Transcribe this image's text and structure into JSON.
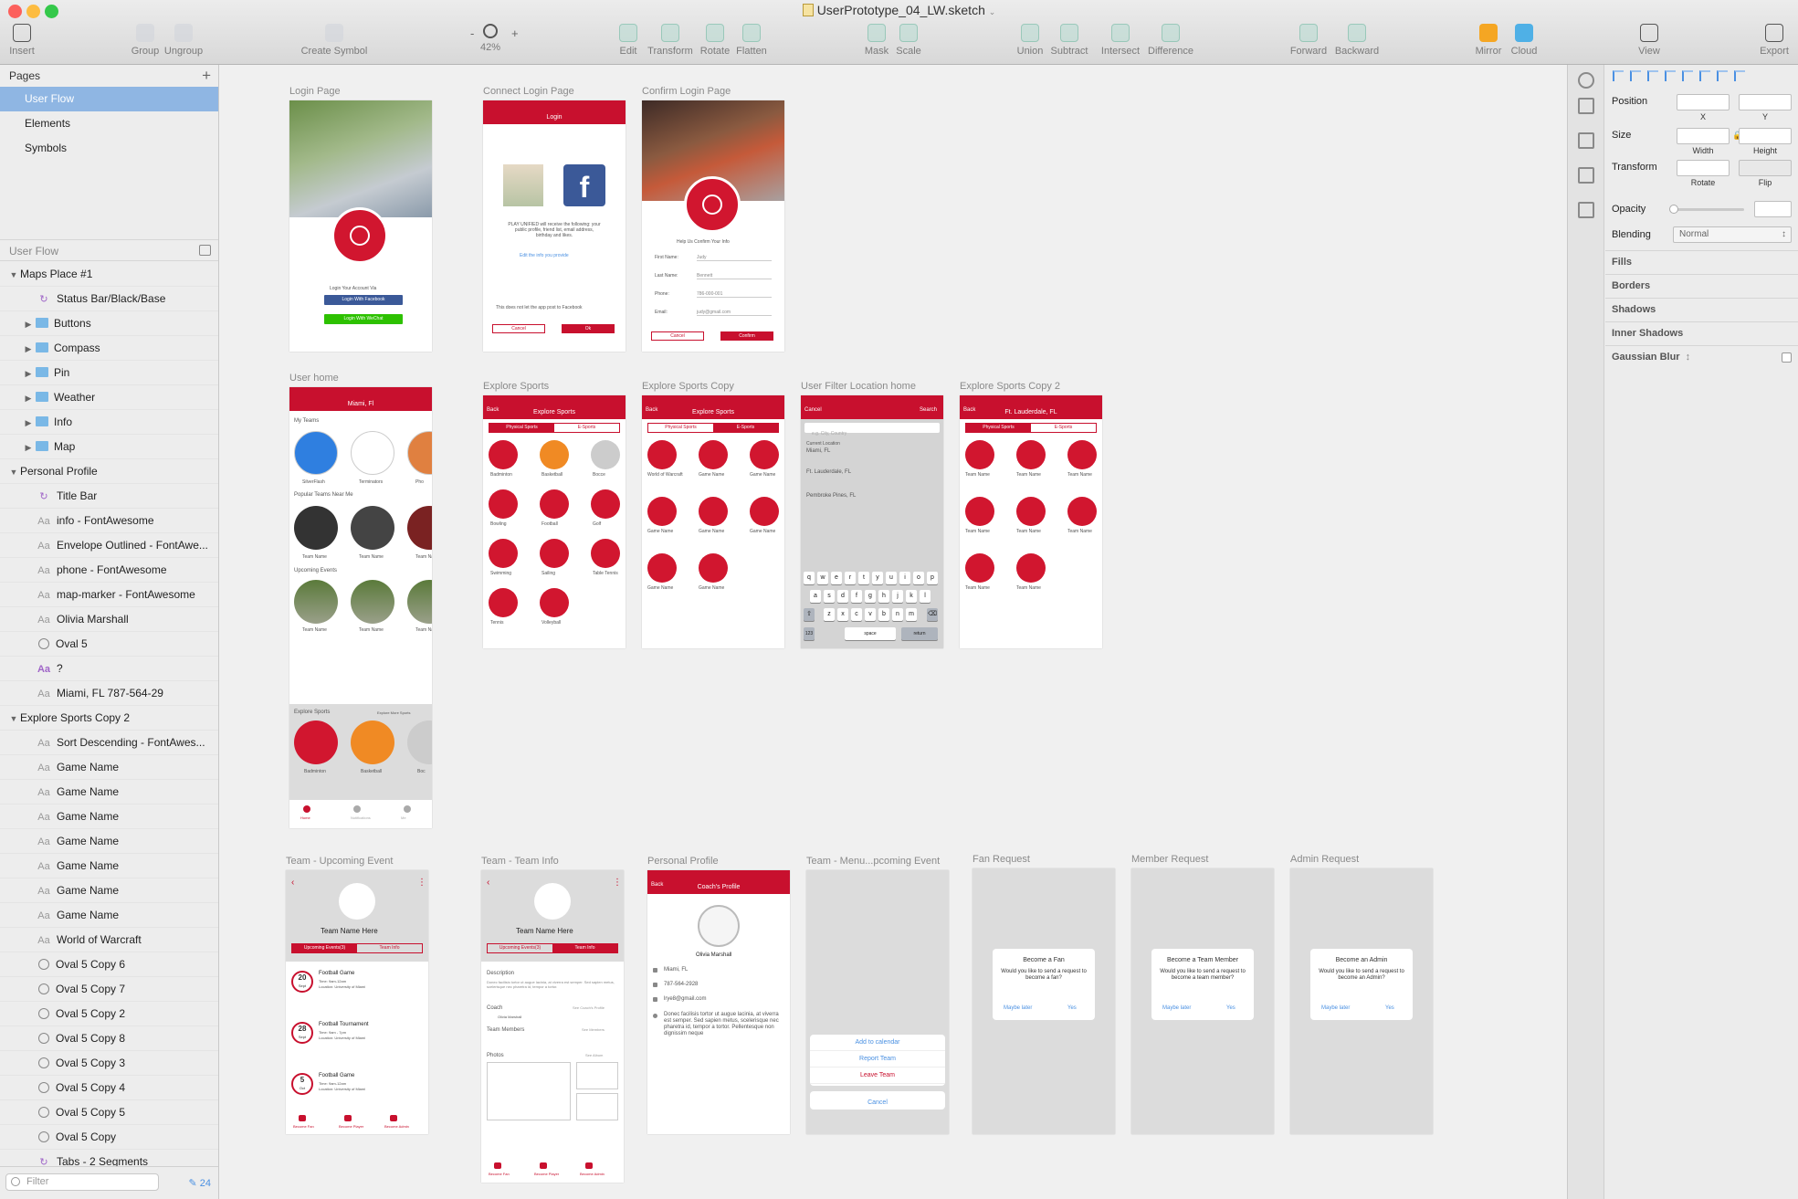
{
  "window": {
    "title": "UserPrototype_04_LW.sketch"
  },
  "toolbar": [
    {
      "id": "insert",
      "label": "Insert",
      "icon": "plus-icon"
    },
    {
      "id": "group",
      "label": "Group",
      "icon": "group-icon"
    },
    {
      "id": "ungroup",
      "label": "Ungroup",
      "icon": "ungroup-icon"
    },
    {
      "id": "create-symbol",
      "label": "Create Symbol",
      "icon": "symbol-icon"
    },
    {
      "id": "zoom",
      "label": "42%",
      "icon": "magnifier-icon"
    },
    {
      "id": "edit",
      "label": "Edit",
      "icon": "pen-icon"
    },
    {
      "id": "transform",
      "label": "Transform",
      "icon": "transform-icon"
    },
    {
      "id": "rotate",
      "label": "Rotate",
      "icon": "rotate-icon"
    },
    {
      "id": "flatten",
      "label": "Flatten",
      "icon": "flatten-icon"
    },
    {
      "id": "mask",
      "label": "Mask",
      "icon": "mask-icon"
    },
    {
      "id": "scale",
      "label": "Scale",
      "icon": "scale-icon"
    },
    {
      "id": "union",
      "label": "Union",
      "icon": "union-icon"
    },
    {
      "id": "subtract",
      "label": "Subtract",
      "icon": "subtract-icon"
    },
    {
      "id": "intersect",
      "label": "Intersect",
      "icon": "intersect-icon"
    },
    {
      "id": "difference",
      "label": "Difference",
      "icon": "difference-icon"
    },
    {
      "id": "forward",
      "label": "Forward",
      "icon": "forward-icon"
    },
    {
      "id": "backward",
      "label": "Backward",
      "icon": "backward-icon"
    },
    {
      "id": "mirror",
      "label": "Mirror",
      "icon": "mirror-icon"
    },
    {
      "id": "cloud",
      "label": "Cloud",
      "icon": "cloud-icon"
    },
    {
      "id": "view",
      "label": "View",
      "icon": "view-icon"
    },
    {
      "id": "export",
      "label": "Export",
      "icon": "export-icon"
    }
  ],
  "zoom": {
    "minus": "-",
    "plus": "+"
  },
  "pages": {
    "header": "Pages",
    "items": [
      "User Flow",
      "Elements",
      "Symbols"
    ],
    "selected": "User Flow"
  },
  "layers_header": "User Flow",
  "layers": [
    {
      "label": "Maps Place #1",
      "kind": "group"
    },
    {
      "label": "Status Bar/Black/Base",
      "kind": "symbol"
    },
    {
      "label": "Buttons",
      "kind": "folder"
    },
    {
      "label": "Compass",
      "kind": "folder"
    },
    {
      "label": "Pin",
      "kind": "folder"
    },
    {
      "label": "Weather",
      "kind": "folder"
    },
    {
      "label": "Info",
      "kind": "folder"
    },
    {
      "label": "Map",
      "kind": "folder"
    },
    {
      "label": "Personal Profile",
      "kind": "group"
    },
    {
      "label": "Title Bar",
      "kind": "symbol"
    },
    {
      "label": "info - FontAwesome",
      "kind": "text"
    },
    {
      "label": "Envelope Outlined - FontAwe...",
      "kind": "text"
    },
    {
      "label": "phone - FontAwesome",
      "kind": "text"
    },
    {
      "label": "map-marker - FontAwesome",
      "kind": "text"
    },
    {
      "label": "Olivia Marshall",
      "kind": "text"
    },
    {
      "label": "Oval 5",
      "kind": "oval"
    },
    {
      "label": "?",
      "kind": "text-purple"
    },
    {
      "label": "Miami, FL 787-564-29",
      "kind": "text"
    },
    {
      "label": "Explore Sports Copy 2",
      "kind": "group"
    },
    {
      "label": "Sort Descending - FontAwes...",
      "kind": "text"
    },
    {
      "label": "Game Name",
      "kind": "text"
    },
    {
      "label": "Game Name",
      "kind": "text"
    },
    {
      "label": "Game Name",
      "kind": "text"
    },
    {
      "label": "Game Name",
      "kind": "text"
    },
    {
      "label": "Game Name",
      "kind": "text"
    },
    {
      "label": "Game Name",
      "kind": "text"
    },
    {
      "label": "Game Name",
      "kind": "text"
    },
    {
      "label": "World of Warcraft",
      "kind": "text"
    },
    {
      "label": "Oval 5 Copy 6",
      "kind": "oval"
    },
    {
      "label": "Oval 5 Copy 7",
      "kind": "oval"
    },
    {
      "label": "Oval 5 Copy 2",
      "kind": "oval"
    },
    {
      "label": "Oval 5 Copy 8",
      "kind": "oval"
    },
    {
      "label": "Oval 5 Copy 3",
      "kind": "oval"
    },
    {
      "label": "Oval 5 Copy 4",
      "kind": "oval"
    },
    {
      "label": "Oval 5 Copy 5",
      "kind": "oval"
    },
    {
      "label": "Oval 5 Copy",
      "kind": "oval"
    },
    {
      "label": "Tabs - 2 Segments",
      "kind": "symbol"
    }
  ],
  "filter": {
    "placeholder": "Filter",
    "count": "24"
  },
  "artboards": [
    {
      "title": "Login Page",
      "type": "login"
    },
    {
      "title": "Connect Login Page",
      "type": "connect"
    },
    {
      "title": "Confirm Login Page",
      "type": "confirm"
    },
    {
      "title": "User home",
      "type": "home"
    },
    {
      "title": "Explore Sports",
      "type": "explore"
    },
    {
      "title": "Explore Sports Copy",
      "type": "explore2"
    },
    {
      "title": "User Filter Location home",
      "type": "filter"
    },
    {
      "title": "Explore Sports Copy 2",
      "type": "explore3"
    },
    {
      "title": "Team - Upcoming Event",
      "type": "team-events"
    },
    {
      "title": "Team - Team Info",
      "type": "team-info"
    },
    {
      "title": "Personal Profile",
      "type": "profile"
    },
    {
      "title": "Team - Menu...pcoming Event",
      "type": "menu"
    },
    {
      "title": "Fan Request",
      "type": "fan"
    },
    {
      "title": "Member Request",
      "type": "member"
    },
    {
      "title": "Admin Request",
      "type": "admin"
    }
  ],
  "screens": {
    "login": {
      "account_via": "Login Your Account Via",
      "facebook": "Login With Facebook",
      "wechat": "Login With WeChat"
    },
    "connect": {
      "header": "Login",
      "notice": "PLAY UNIFIED will receive the following: your public profile, friend list, email address, birthday and likes.",
      "edit_link": "Edit the info you provide",
      "no_post": "This does not let the app post to Facebook",
      "cancel": "Cancel",
      "ok": "Ok"
    },
    "confirm": {
      "heading": "Help Us Confirm Your Info",
      "fields": [
        {
          "label": "First Name:",
          "value": "Judy"
        },
        {
          "label": "Last Name:",
          "value": "Bennett"
        },
        {
          "label": "Phone:",
          "value": "786-000-001"
        },
        {
          "label": "Email:",
          "value": "judy@gmail.com"
        }
      ],
      "cancel": "Cancel",
      "confirm": "Confirm"
    },
    "home": {
      "location": "Miami, Fl",
      "my_teams": "My Teams",
      "teams": [
        "SilverFlash",
        "Terminators",
        "Pho"
      ],
      "popular": "Popular Teams Near Me",
      "team_name": "Team Name",
      "upcoming": "Upcoming Events",
      "event_team": "Team Name",
      "explore": "Explore Sports",
      "explore_more": "Explore More Sports",
      "sports": [
        "Badminton",
        "Basketball",
        "Boc"
      ],
      "tabs": [
        "Home",
        "Notifications",
        "Me"
      ]
    },
    "explore": {
      "back": "Back",
      "title": "Explore Sports",
      "seg": [
        "Physical Sports",
        "E-Sports"
      ],
      "sports": [
        "Badminton",
        "Basketball",
        "Bocce",
        "Bowling",
        "Football",
        "Golf",
        "Swimming",
        "Sailing",
        "Table Tennis",
        "Tennis",
        "Volleyball"
      ]
    },
    "explore2": {
      "back": "Back",
      "title": "Explore Sports",
      "seg": [
        "Physical Sports",
        "E-Sports"
      ],
      "games": [
        "World of Warcraft",
        "Game Name",
        "Game Name",
        "Game Name",
        "Game Name",
        "Game Name",
        "Game Name",
        "Game Name"
      ]
    },
    "filter": {
      "cancel": "Cancel",
      "search": "Search",
      "placeholder": "e.g. City, Country",
      "current_label": "Current Location",
      "current_value": "Miami, FL",
      "options": [
        "Ft. Lauderdale, FL",
        "Pembroke Pines, FL"
      ],
      "keys1": [
        "q",
        "w",
        "e",
        "r",
        "t",
        "y",
        "u",
        "i",
        "o",
        "p"
      ],
      "keys2": [
        "a",
        "s",
        "d",
        "f",
        "g",
        "h",
        "j",
        "k",
        "l"
      ],
      "keys3": [
        "z",
        "x",
        "c",
        "v",
        "b",
        "n",
        "m"
      ],
      "space": "space",
      "return": "return",
      "num": "123"
    },
    "explore3": {
      "back": "Back",
      "location": "Ft. Lauderdale, FL",
      "seg": [
        "Physical Sports",
        "E-Sports"
      ],
      "team_name": "Team Name"
    },
    "team_events": {
      "team_name": "Team Name Here",
      "seg": [
        "Upcoming Events(3)",
        "Team Info"
      ],
      "events": [
        {
          "day": "20",
          "month": "Sept",
          "title": "Football Game",
          "time": "Time: 9am-12am",
          "loc": "Location: University of Miami"
        },
        {
          "day": "28",
          "month": "Sept",
          "title": "Football Tournament",
          "time": "Time: 9am - 7pm",
          "loc": "Location: University of Miami"
        },
        {
          "day": "5",
          "month": "Oct",
          "title": "Football Game",
          "time": "Time: 9am-12am",
          "loc": "Location: University of Miami"
        }
      ],
      "actions": [
        "Become Fan",
        "Become Player",
        "Become Admin"
      ]
    },
    "team_info": {
      "team_name": "Team Name Here",
      "seg": [
        "Upcoming Events(3)",
        "Team Info"
      ],
      "description": "Description",
      "desc_text": "Donec facilisis tortor ut augue lacinia, at viverra est semper. Sed sapien metus, scelerisque nec pharetra id, tempor a tortor.",
      "coach": "Coach",
      "coach_name": "Olivia Marshall",
      "members": "Team Members",
      "photos": "Photos",
      "see_profile": "See Coach's Profile",
      "see_members": "See Members",
      "see_album": "See Album",
      "actions": [
        "Become Fan",
        "Become Player",
        "Become Admin"
      ]
    },
    "profile": {
      "back": "Back",
      "title": "Coach's Profile",
      "name": "Olivia Marshall",
      "location": "Miami, FL",
      "phone": "787-564-2928",
      "email": "lrye8@gmail.com",
      "bio": "Donec facilisis tortor ut augue lacinia, at viverra est semper. Sed sapien metus, scelerisque nec pharetra id, tempor a tortor. Pellentesque non dignissim neque"
    },
    "menu": {
      "items": [
        "Add to calendar",
        "Report Team",
        "Leave Team"
      ],
      "cancel": "Cancel"
    },
    "fan": {
      "title": "Become a Fan",
      "body": "Would you like to send a request to become a fan?",
      "maybe": "Maybe later",
      "yes": "Yes"
    },
    "member": {
      "title": "Become a Team Member",
      "body": "Would you like to send a request to become a team member?",
      "maybe": "Maybe later",
      "yes": "Yes"
    },
    "admin": {
      "title": "Become an Admin",
      "body": "Would you like to send a request to become an Admin?",
      "maybe": "Maybe later",
      "yes": "Yes"
    }
  },
  "inspector": {
    "position": "Position",
    "x": "X",
    "y": "Y",
    "size": "Size",
    "width": "Width",
    "height": "Height",
    "transform": "Transform",
    "rotate": "Rotate",
    "flip": "Flip",
    "opacity": "Opacity",
    "blending": "Blending",
    "blending_value": "Normal",
    "sections": [
      "Fills",
      "Borders",
      "Shadows",
      "Inner Shadows",
      "Gaussian Blur"
    ]
  },
  "colors": {
    "brand_red": "#c8102e",
    "selection": "#8fb6e3",
    "facebook": "#3b5998",
    "wechat": "#2dc100"
  }
}
